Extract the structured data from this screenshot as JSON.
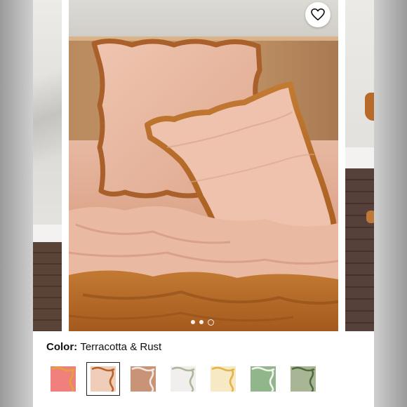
{
  "product": {
    "color_label": "Color:",
    "color_value": "Terracotta & Rust"
  },
  "icons": {
    "wishlist": "heart-outline-icon"
  },
  "carousel": {
    "dot_count": 3,
    "active_index": 2
  },
  "swatches": [
    {
      "name": "coral-pink",
      "fill": "#f0807c",
      "trim": "#e2a43a",
      "selected": false
    },
    {
      "name": "terracotta-rust",
      "fill": "#f0cdb8",
      "trim": "#b8622a",
      "selected": true
    },
    {
      "name": "clay",
      "fill": "#c99378",
      "trim": "#f2e9e3",
      "selected": false
    },
    {
      "name": "white-sage",
      "fill": "#f2eeee",
      "trim": "#a9b79a",
      "selected": false
    },
    {
      "name": "cream-gold",
      "fill": "#f6e9c4",
      "trim": "#e2b446",
      "selected": false
    },
    {
      "name": "sage-white",
      "fill": "#92b68c",
      "trim": "#f3f3ef",
      "selected": false
    },
    {
      "name": "olive",
      "fill": "#a9b696",
      "trim": "#4f6b40",
      "selected": false
    }
  ]
}
